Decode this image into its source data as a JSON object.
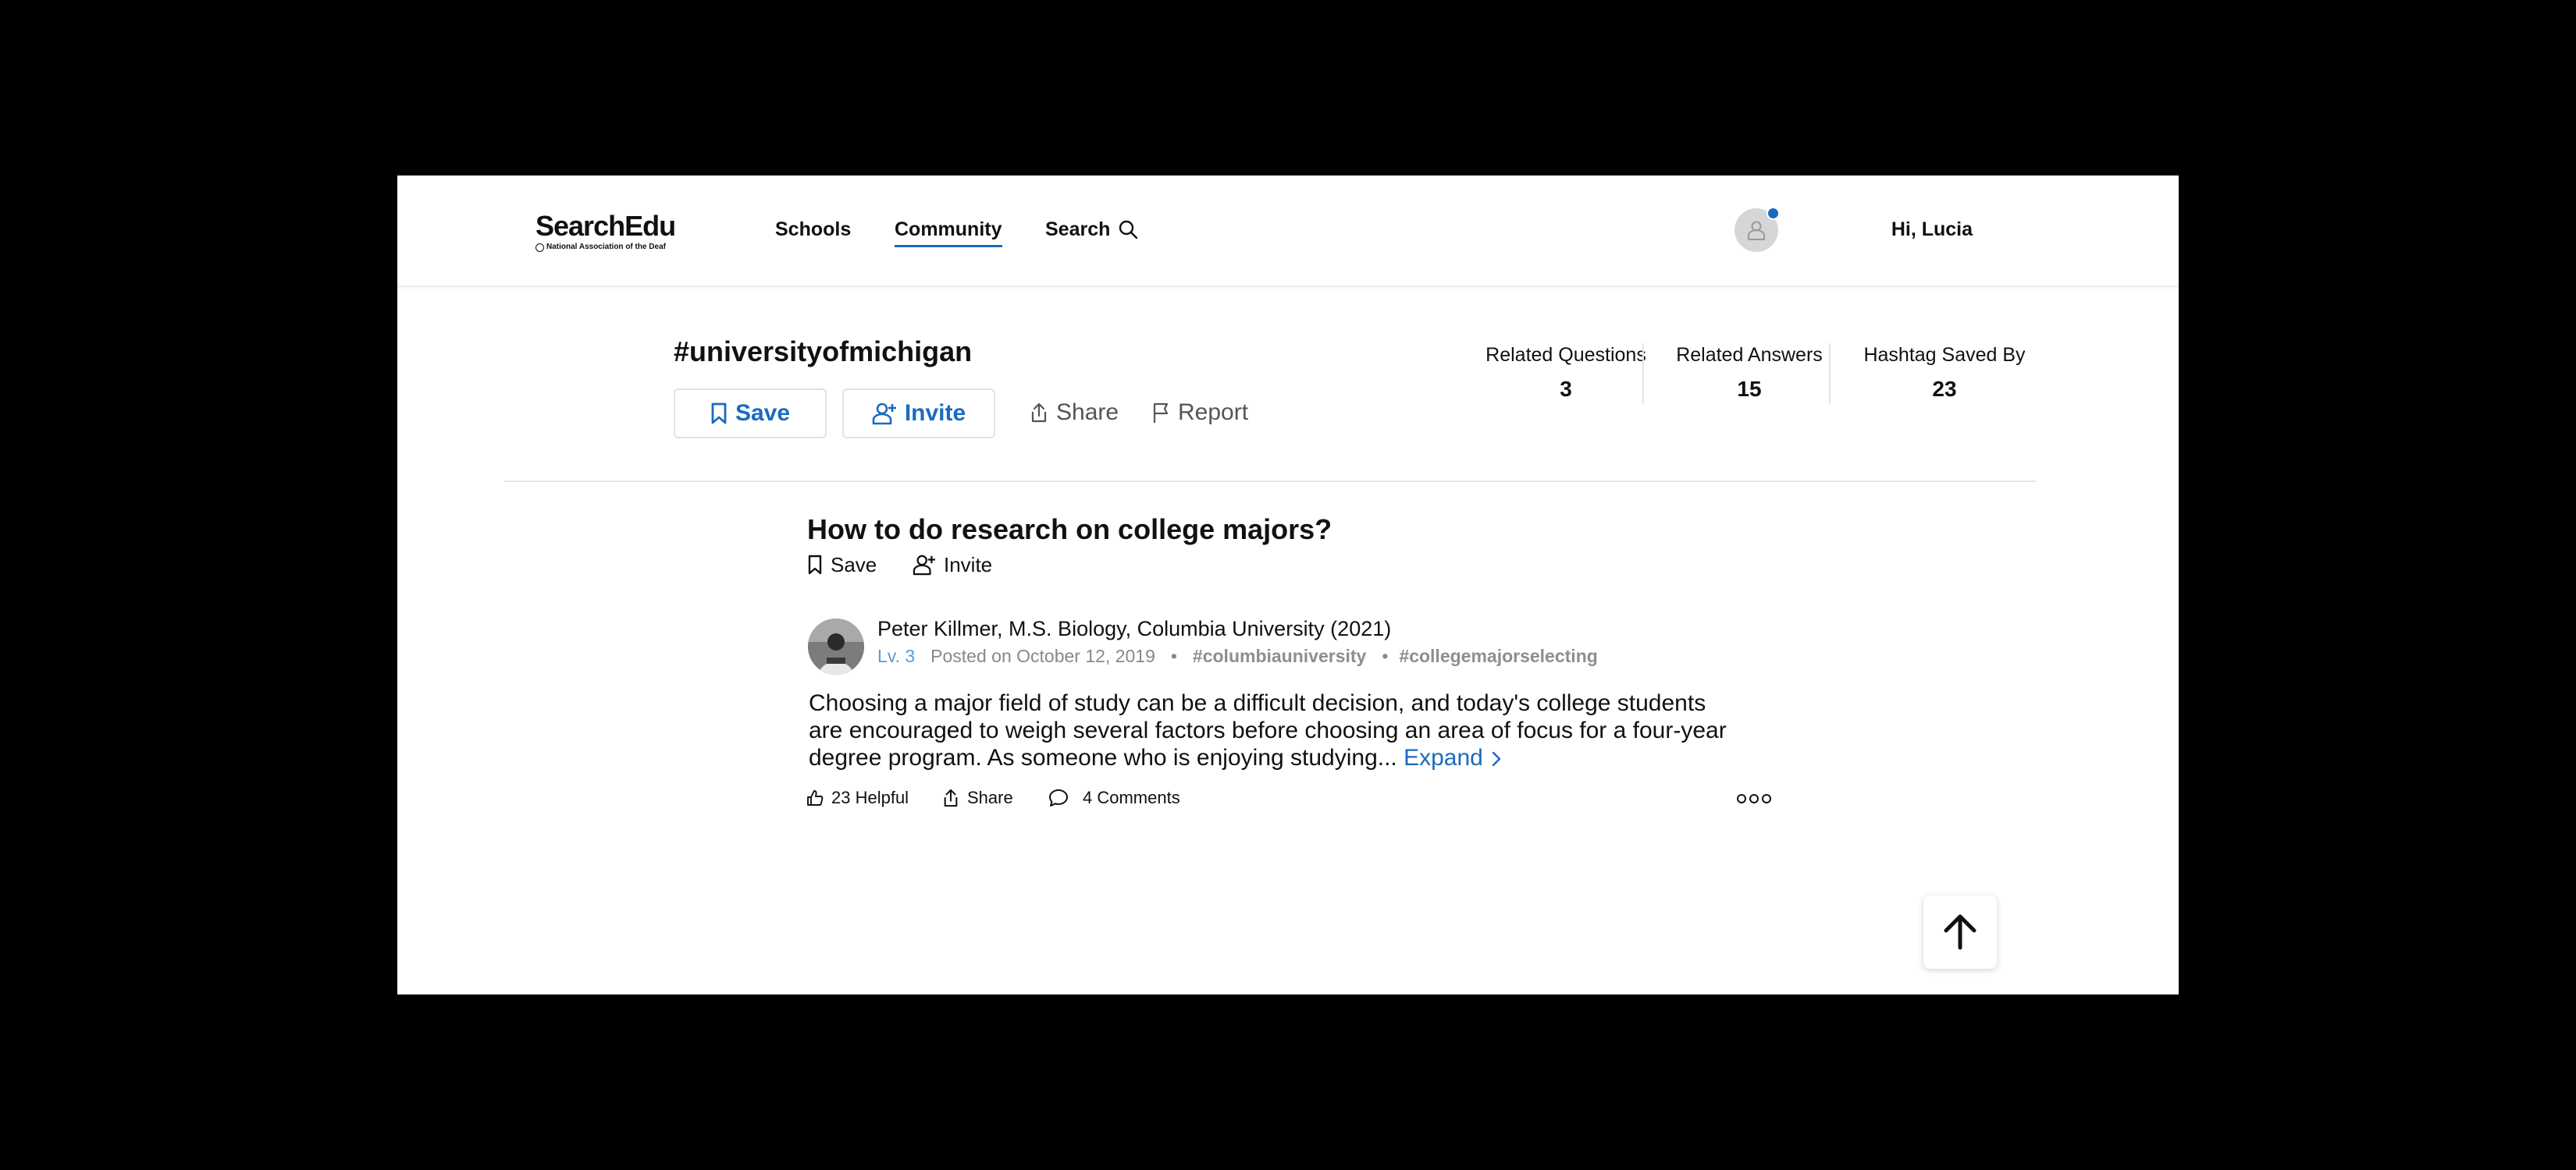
{
  "header": {
    "logo_name": "SearchEdu",
    "logo_subtitle": "National Association of the Deaf",
    "nav": {
      "schools": "Schools",
      "community": "Community",
      "search": "Search"
    },
    "greeting": "Hi, Lucia"
  },
  "hashtag": {
    "title": "#universityofmichigan",
    "save_label": "Save",
    "invite_label": "Invite",
    "share_label": "Share",
    "report_label": "Report",
    "stats": [
      {
        "label": "Related Questions",
        "value": "3"
      },
      {
        "label": "Related Answers",
        "value": "15"
      },
      {
        "label": "Hashtag Saved By",
        "value": "23"
      }
    ]
  },
  "question": {
    "title": "How to do research on college majors?",
    "save_label": "Save",
    "invite_label": "Invite",
    "answer": {
      "author": "Peter Killmer, M.S. Biology, Columbia University (2021)",
      "level": "Lv. 3",
      "posted": "Posted on October 12, 2019",
      "bullet": "•",
      "tags": [
        "#columbiauniversity",
        "#collegemajorselecting"
      ],
      "text": "Choosing a major field of study can be a difficult decision, and today's college students are encouraged to weigh several factors before choosing an area of focus for a four-year degree program. As someone who is enjoying studying...",
      "expand_label": "Expand",
      "helpful_label": "23 Helpful",
      "share_label": "Share",
      "comments_label": "4 Comments"
    }
  },
  "colors": {
    "accent": "#1a6bbf",
    "level": "#5c9ad8",
    "muted": "#888888"
  },
  "icons": [
    "search-icon",
    "user-icon",
    "bookmark-icon",
    "add-user-icon",
    "share-icon",
    "flag-icon",
    "thumbs-up-icon",
    "comment-icon",
    "more-icon",
    "arrow-up-icon",
    "chevron-right-icon"
  ]
}
